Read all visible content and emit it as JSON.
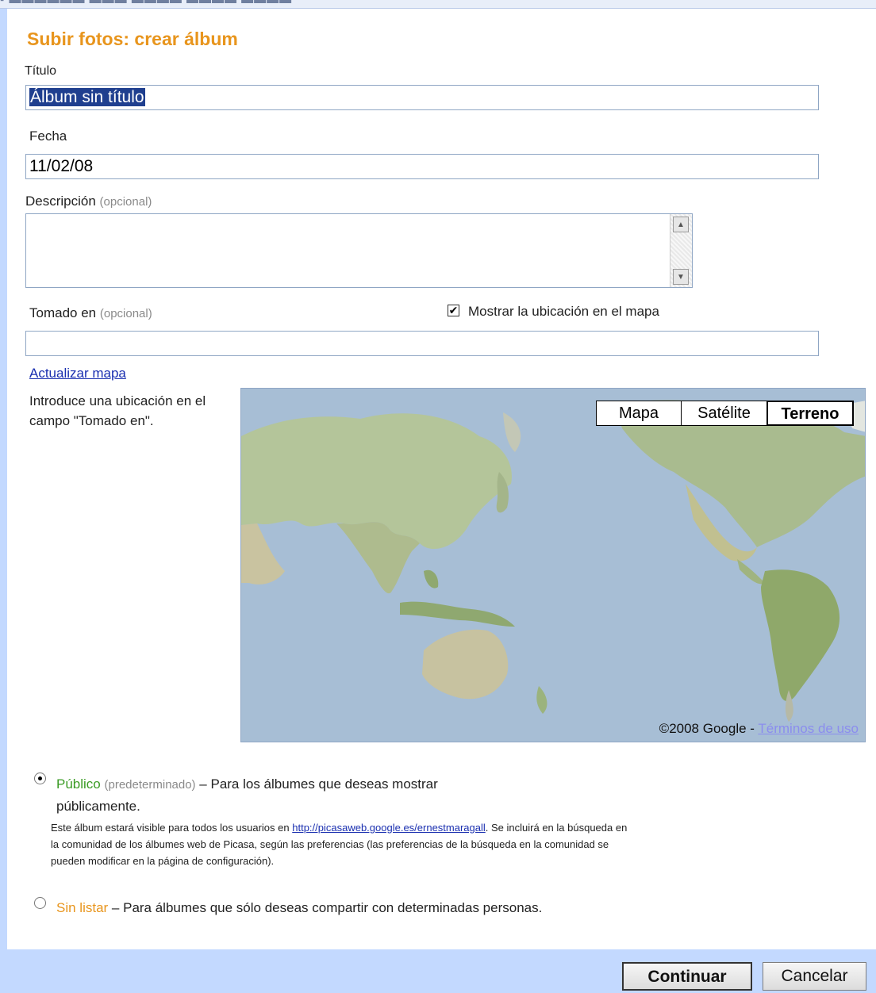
{
  "header": {
    "title": "Subir fotos: crear álbum"
  },
  "fields": {
    "title_label": "Título",
    "title_value_selected": "Álbum sin título",
    "date_label": "Fecha",
    "date_value": "11/02/08",
    "description_label": "Descripción",
    "description_optional": "(opcional)",
    "taken_label": "Tomado en",
    "taken_optional": "(opcional)",
    "show_location_label": "Mostrar la ubicación en el mapa",
    "show_location_checked": true
  },
  "map": {
    "update_link": "Actualizar mapa",
    "hint": "Introduce una ubicación en el campo \"Tomado en\".",
    "types": [
      "Mapa",
      "Satélite",
      "Terreno"
    ],
    "selected_type": "Terreno",
    "copyright": "©2008 Google -",
    "terms": "Términos de uso"
  },
  "visibility": {
    "public_label": "Público",
    "public_default": "(predeterminado)",
    "public_desc": "– Para los álbumes que deseas mostrar públicamente.",
    "public_info_1": "Este álbum estará visible para todos los usuarios en",
    "public_url": "http://picasaweb.google.es/ernestmaragall",
    "public_info_2": "Se incluirá en la búsqueda en la comunidad de los álbumes web de Picasa, según las preferencias (las preferencias de la búsqueda en la comunidad se pueden modificar en la página de configuración).",
    "unlisted_label": "Sin listar",
    "unlisted_desc": "– Para álbumes que sólo deseas compartir con determinadas personas.",
    "selected": "public"
  },
  "buttons": {
    "continue": "Continuar",
    "cancel": "Cancelar"
  },
  "colors": {
    "title": "#e8951d",
    "public_label": "#3a9b24",
    "unlisted_label": "#e8951d",
    "link": "#1a2fb0",
    "frame": "#c3d9ff"
  }
}
